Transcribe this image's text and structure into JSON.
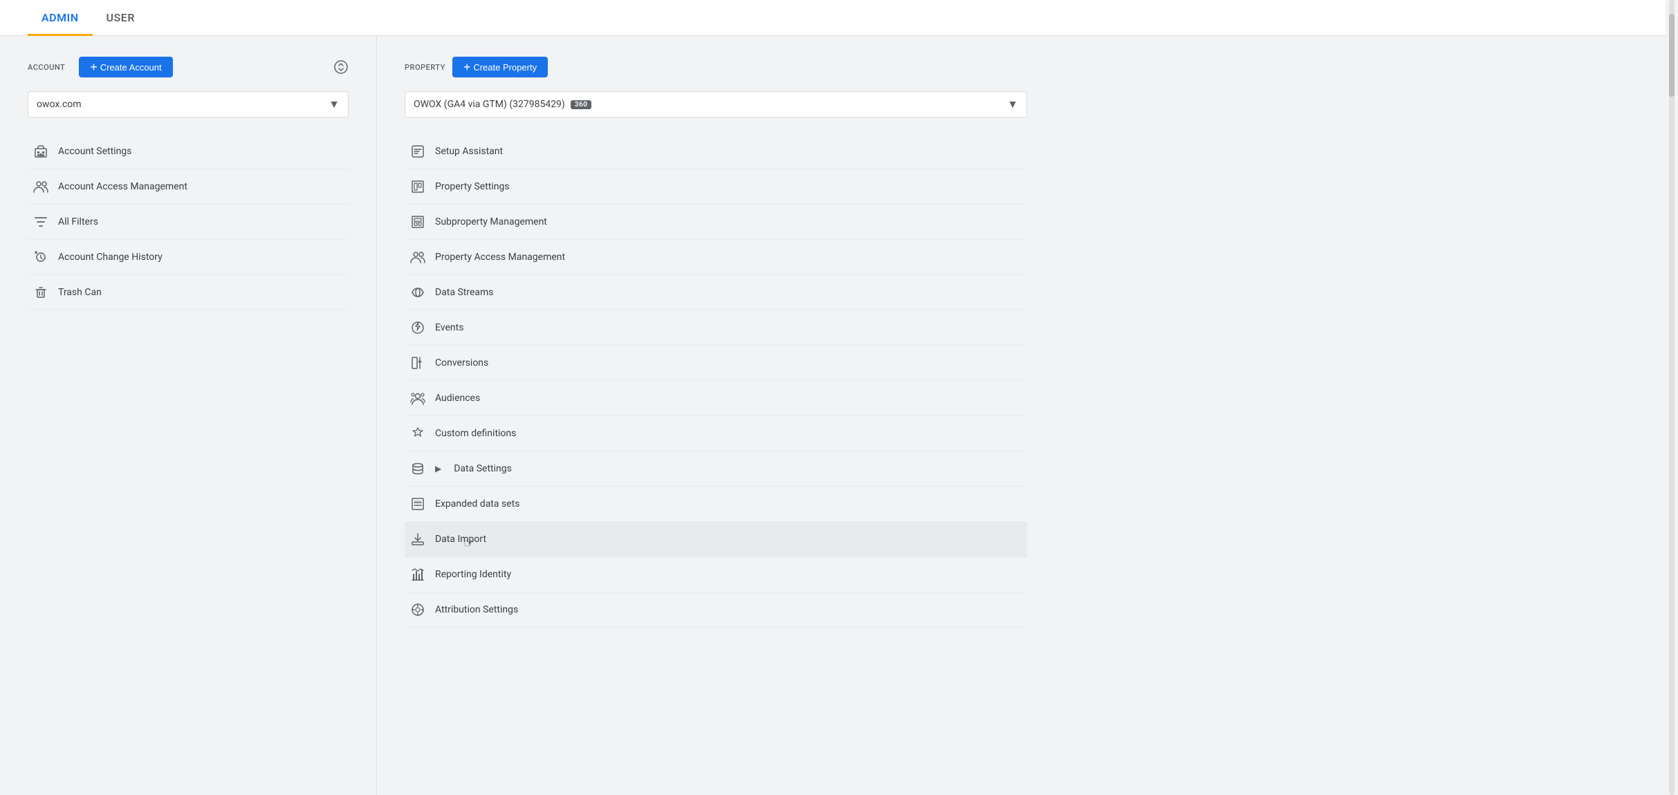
{
  "top_nav": {
    "tabs": [
      {
        "label": "ADMIN",
        "active": true
      },
      {
        "label": "USER",
        "active": false
      }
    ]
  },
  "account_section": {
    "label": "Account",
    "create_button": "Create Account",
    "selected_account": "owox.com",
    "menu_items": [
      {
        "id": "account-settings",
        "label": "Account Settings",
        "icon": "building-icon"
      },
      {
        "id": "account-access-management",
        "label": "Account Access Management",
        "icon": "people-icon"
      },
      {
        "id": "all-filters",
        "label": "All Filters",
        "icon": "filter-icon"
      },
      {
        "id": "account-change-history",
        "label": "Account Change History",
        "icon": "history-icon"
      },
      {
        "id": "trash-can",
        "label": "Trash Can",
        "icon": "trash-icon"
      }
    ]
  },
  "property_section": {
    "label": "Property",
    "create_button": "Create Property",
    "selected_property": "OWOX (GA4 via GTM) (327985429)",
    "badge": "360",
    "menu_items": [
      {
        "id": "setup-assistant",
        "label": "Setup Assistant",
        "icon": "setup-icon",
        "highlighted": false
      },
      {
        "id": "property-settings",
        "label": "Property Settings",
        "icon": "property-settings-icon",
        "highlighted": false
      },
      {
        "id": "subproperty-management",
        "label": "Subproperty Management",
        "icon": "subproperty-icon",
        "highlighted": false
      },
      {
        "id": "property-access-management",
        "label": "Property Access Management",
        "icon": "property-access-icon",
        "highlighted": false
      },
      {
        "id": "data-streams",
        "label": "Data Streams",
        "icon": "data-streams-icon",
        "highlighted": false
      },
      {
        "id": "events",
        "label": "Events",
        "icon": "events-icon",
        "highlighted": false
      },
      {
        "id": "conversions",
        "label": "Conversions",
        "icon": "conversions-icon",
        "highlighted": false
      },
      {
        "id": "audiences",
        "label": "Audiences",
        "icon": "audiences-icon",
        "highlighted": false
      },
      {
        "id": "custom-definitions",
        "label": "Custom definitions",
        "icon": "custom-definitions-icon",
        "highlighted": false
      },
      {
        "id": "data-settings",
        "label": "Data Settings",
        "icon": "data-settings-icon",
        "has_arrow": true,
        "highlighted": false
      },
      {
        "id": "expanded-data-sets",
        "label": "Expanded data sets",
        "icon": "expanded-data-icon",
        "highlighted": false
      },
      {
        "id": "data-import",
        "label": "Data Import",
        "icon": "data-import-icon",
        "highlighted": true
      },
      {
        "id": "reporting-identity",
        "label": "Reporting Identity",
        "icon": "reporting-icon",
        "highlighted": false
      },
      {
        "id": "attribution-settings",
        "label": "Attribution Settings",
        "icon": "attribution-icon",
        "highlighted": false
      }
    ]
  }
}
